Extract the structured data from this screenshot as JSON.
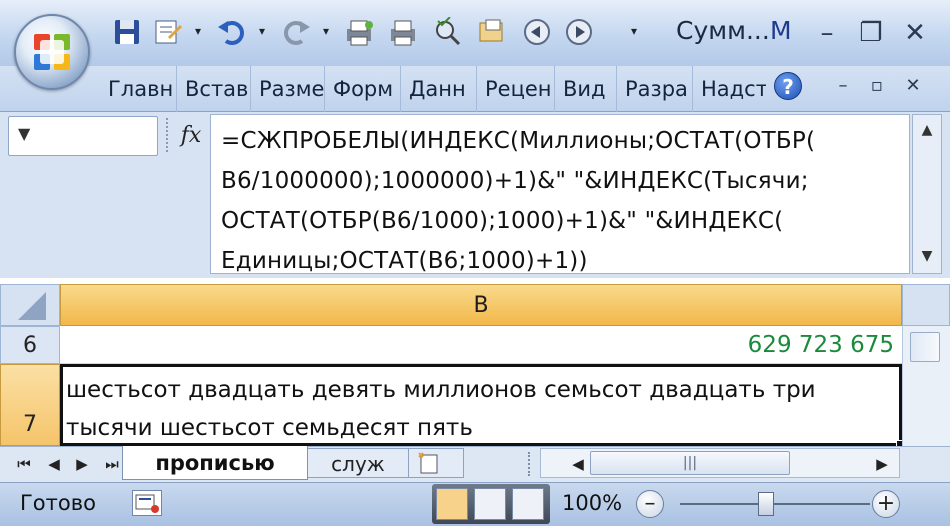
{
  "window": {
    "title": "Сумм...",
    "title_suffix": "M",
    "controls": [
      "–",
      "❐",
      "✕"
    ]
  },
  "quick_access": {
    "icons": [
      "save-icon",
      "form-icon",
      "undo-icon",
      "redo-icon",
      "print-preview-icon",
      "print-icon",
      "spell-check-icon",
      "open-icon",
      "back-icon",
      "forward-icon",
      "customize-icon"
    ]
  },
  "ribbon": {
    "tabs": [
      "Главн",
      "Встав",
      "Разме",
      "Форм",
      "Данн",
      "Рецен",
      "Вид",
      "Разра",
      "Надст"
    ],
    "help_label": "?",
    "controls": [
      "–",
      "▫",
      "✕"
    ]
  },
  "formula_bar": {
    "name_box": "",
    "fx_label": "fx",
    "formula": "=СЖПРОБЕЛЫ(ИНДЕКС(Миллионы;ОСТАТ(ОТБР(\nB6/1000000);1000000)+1)&\" \"&ИНДЕКС(Тысячи;\nОСТАТ(ОТБР(B6/1000);1000)+1)&\" \"&ИНДЕКС(\nЕдиницы;ОСТАТ(B6;1000)+1))"
  },
  "grid": {
    "column_header": "B",
    "rows": [
      {
        "header": "6",
        "value": "629 723 675"
      },
      {
        "header": "7",
        "value": "шестьсот двадцать девять миллионов семьсот двадцать три тысячи шестьсот семьдесят пять"
      }
    ]
  },
  "sheets": {
    "nav_buttons": [
      "⏮",
      "◀",
      "▶",
      "⏭"
    ],
    "tabs": [
      "прописью",
      "служ"
    ],
    "active": "прописью"
  },
  "status_bar": {
    "ready": "Готово",
    "zoom": "100%",
    "zoom_out": "–",
    "zoom_in": "+"
  },
  "colors": {
    "selected_header": "#f5c46a",
    "number_green": "#1a8a3c",
    "ribbon_bg": "#c0d3ed"
  }
}
